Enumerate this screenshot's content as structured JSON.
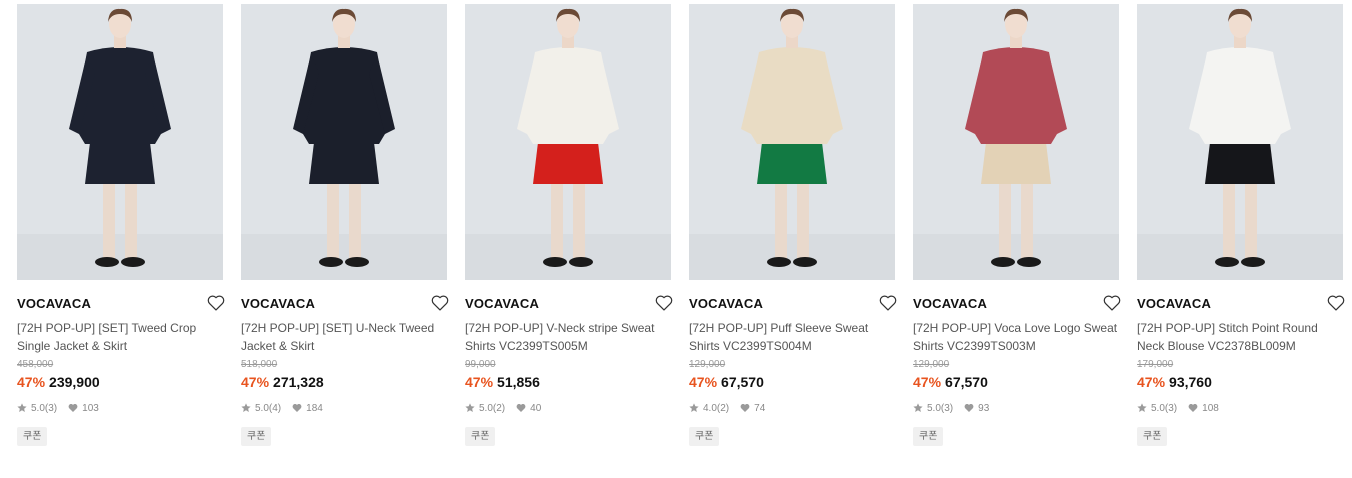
{
  "products": [
    {
      "brand": "VOCAVACA",
      "name": "[72H POP-UP] [SET] Tweed Crop Single Jacket & Skirt",
      "original_price": "458,000",
      "discount": "47%",
      "price": "239,900",
      "rating": "5.0",
      "reviews": "(3)",
      "likes": "103",
      "badge": "쿠폰",
      "image": "model-navy-tweed-jacket-skirt",
      "top_color": "#1d2230",
      "bottom_color": "#1d2230"
    },
    {
      "brand": "VOCAVACA",
      "name": "[72H POP-UP] [SET] U-Neck Tweed Jacket & Skirt",
      "original_price": "518,000",
      "discount": "47%",
      "price": "271,328",
      "rating": "5.0",
      "reviews": "(4)",
      "likes": "184",
      "badge": "쿠폰",
      "image": "model-navy-u-neck-jacket-skirt",
      "top_color": "#1b1f2b",
      "bottom_color": "#1b1f2b"
    },
    {
      "brand": "VOCAVACA",
      "name": "[72H POP-UP] V-Neck stripe Sweat Shirts VC2399TS005M",
      "original_price": "99,000",
      "discount": "47%",
      "price": "51,856",
      "rating": "5.0",
      "reviews": "(2)",
      "likes": "40",
      "badge": "쿠폰",
      "image": "model-stripe-sweatshirt-red-pants",
      "top_color": "#f2f0ea",
      "bottom_color": "#d4201c"
    },
    {
      "brand": "VOCAVACA",
      "name": "[72H POP-UP] Puff Sleeve Sweat Shirts VC2399TS004M",
      "original_price": "129,000",
      "discount": "47%",
      "price": "67,570",
      "rating": "4.0",
      "reviews": "(2)",
      "likes": "74",
      "badge": "쿠폰",
      "image": "model-beige-sweatshirt-green-pants",
      "top_color": "#e9dcc4",
      "bottom_color": "#127a43"
    },
    {
      "brand": "VOCAVACA",
      "name": "[72H POP-UP] Voca Love Logo Sweat Shirts VC2399TS003M",
      "original_price": "129,000",
      "discount": "47%",
      "price": "67,570",
      "rating": "5.0",
      "reviews": "(3)",
      "likes": "93",
      "badge": "쿠폰",
      "image": "model-red-logo-sweatshirt",
      "top_color": "#b24a56",
      "bottom_color": "#e3d2b6"
    },
    {
      "brand": "VOCAVACA",
      "name": "[72H POP-UP] Stitch Point Round Neck Blouse VC2378BL009M",
      "original_price": "179,000",
      "discount": "47%",
      "price": "93,760",
      "rating": "5.0",
      "reviews": "(3)",
      "likes": "108",
      "badge": "쿠폰",
      "image": "model-white-blouse-black-skirt",
      "top_color": "#f4f4f2",
      "bottom_color": "#15161a"
    }
  ],
  "colors": {
    "accent": "#e8541f",
    "background": "#ffffff",
    "photo_backdrop": "#dfe3e7"
  }
}
